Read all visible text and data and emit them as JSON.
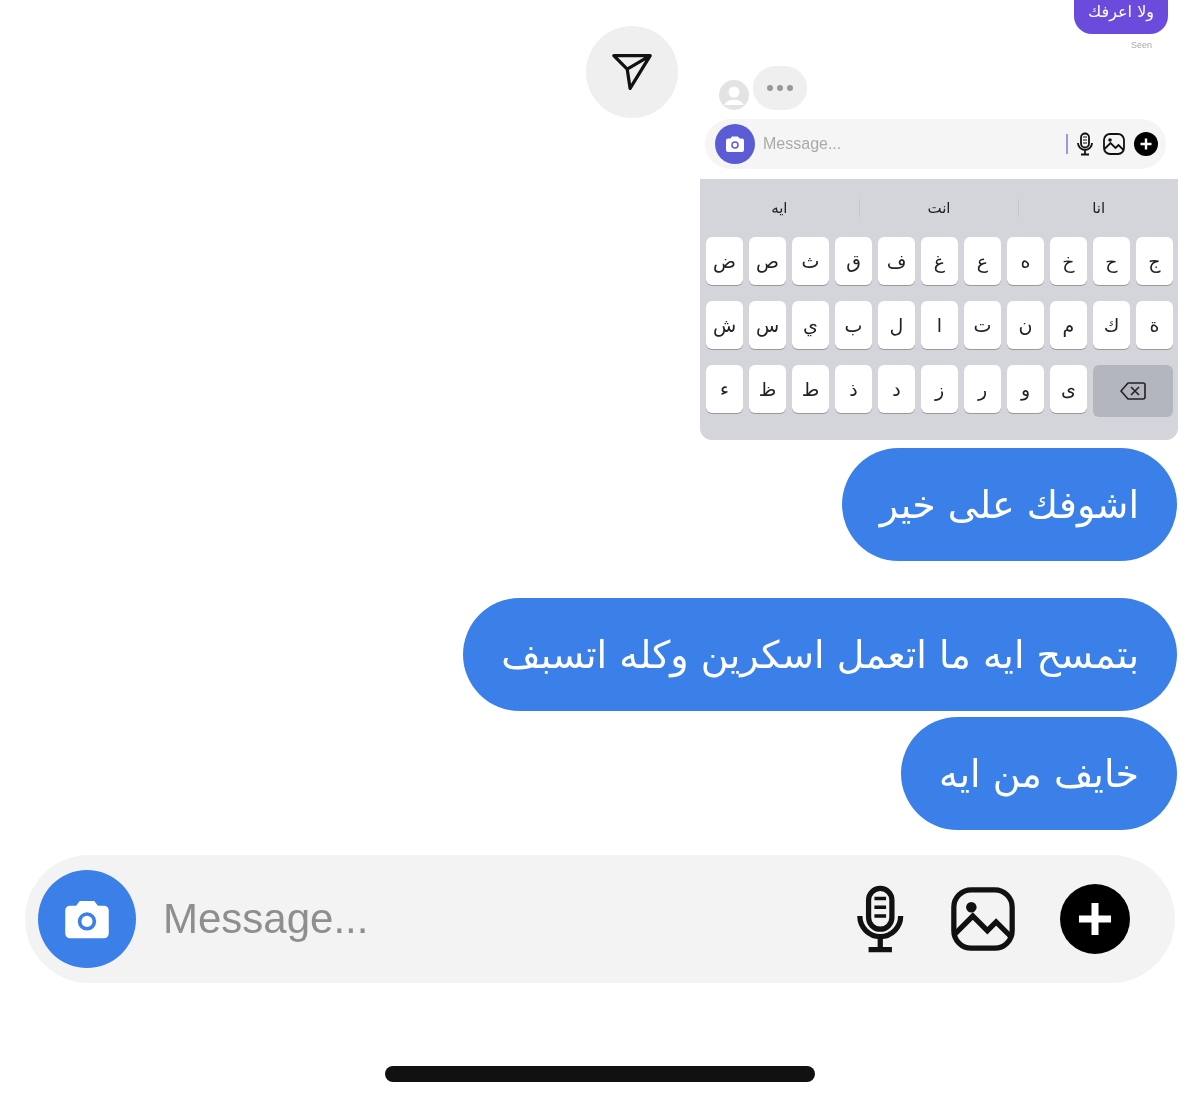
{
  "shared_screenshot": {
    "sent_message": {
      "text": "ولا اعرفك"
    },
    "status": "Seen",
    "typing": true,
    "message_bar": {
      "placeholder": "Message..."
    },
    "keyboard": {
      "suggestions": [
        "انا",
        "انت",
        "ايه"
      ],
      "rows": [
        [
          "ج",
          "ح",
          "خ",
          "ه",
          "ع",
          "غ",
          "ف",
          "ق",
          "ث",
          "ص",
          "ض"
        ],
        [
          "ة",
          "ك",
          "م",
          "ن",
          "ت",
          "ا",
          "ل",
          "ب",
          "ي",
          "س",
          "ش"
        ]
      ],
      "bottom_row": [
        "ى",
        "و",
        "ر",
        "ز",
        "د",
        "ذ",
        "ط",
        "ظ",
        "ء"
      ]
    }
  },
  "messages": [
    {
      "text": "اشوفك على خير"
    },
    {
      "text": "بتمسح ايه ما اتعمل اسكرين وكله اتسبف"
    },
    {
      "text": "خايف من ايه"
    }
  ],
  "composer": {
    "placeholder": "Message..."
  }
}
